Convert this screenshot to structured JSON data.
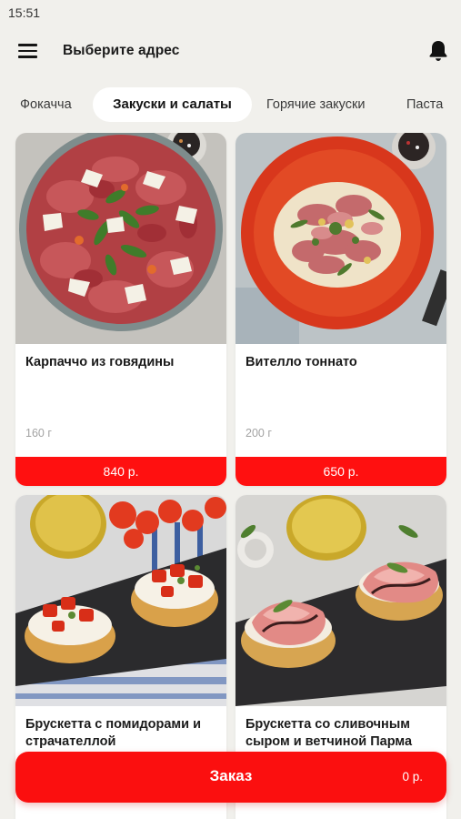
{
  "status_bar": {
    "time": "15:51"
  },
  "header": {
    "menu_icon": "hamburger-menu-icon",
    "address_title": "Выберите адрес",
    "notification_icon": "bell-icon"
  },
  "category_tabs": [
    {
      "label": "Фокачча",
      "active": false
    },
    {
      "label": "Закуски и салаты",
      "active": true
    },
    {
      "label": "Горячие закуски",
      "active": false
    },
    {
      "label": "Паста",
      "active": false
    }
  ],
  "products": [
    {
      "name": "Карпаччо из говядины",
      "weight": "160 г",
      "price": "840 р."
    },
    {
      "name": "Вителло тоннато",
      "weight": "200 г",
      "price": "650 р."
    },
    {
      "name": "Брускетта с помидорами и страчателлой",
      "weight": "",
      "price": ""
    },
    {
      "name": "Брускетта со сливочным сыром и ветчиной Парма",
      "weight": "",
      "price": ""
    }
  ],
  "order_bar": {
    "label": "Заказ",
    "total": "0 р."
  },
  "colors": {
    "accent": "#fb0f0f",
    "background": "#f1f0ec",
    "card": "#ffffff"
  }
}
